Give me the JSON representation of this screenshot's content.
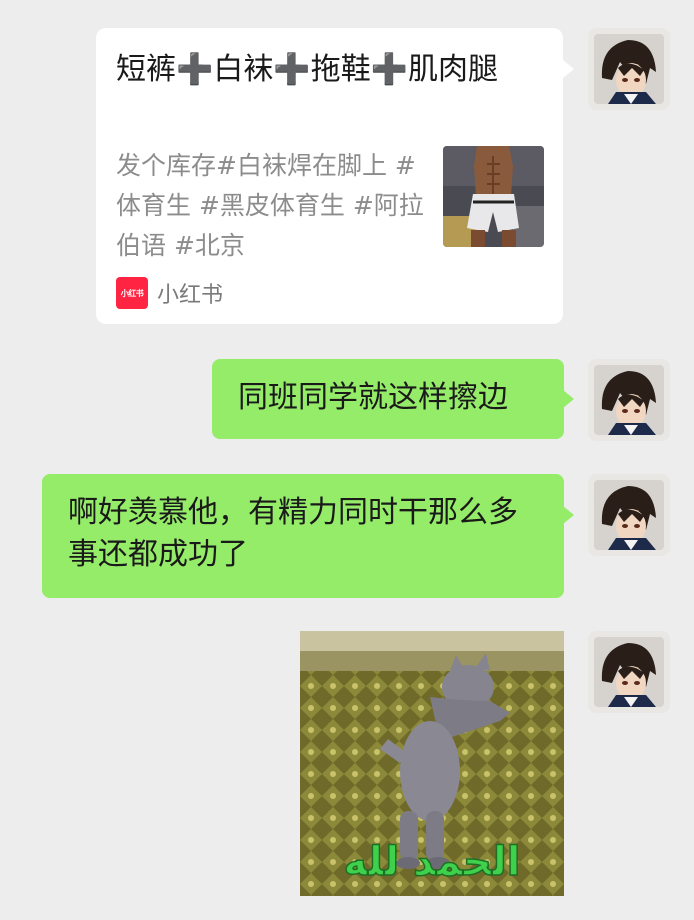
{
  "messages": {
    "link_card": {
      "title": "短裤➕白袜➕拖鞋➕肌肉腿",
      "description": "发个库存#白袜焊在脚上 #体育生 #黑皮体育生 #阿拉伯语 #北京",
      "source_logo_text": "小红书",
      "source_name": "小红书",
      "thumbnail": "shirtless-athlete-photo"
    },
    "text_1": "同班同学就这样擦边",
    "text_2": "啊好羡慕他，有精力同时干那么多事还都成功了",
    "sticker": {
      "subject": "cat-standing-on-rug",
      "caption": "الحمد لله"
    }
  },
  "avatar": "anime-boy-avatar",
  "colors": {
    "background": "#ededed",
    "bubble_self": "#95ec69",
    "card": "#ffffff",
    "xiaohongshu_red": "#ff2442",
    "sticker_text": "#3fd14b"
  }
}
